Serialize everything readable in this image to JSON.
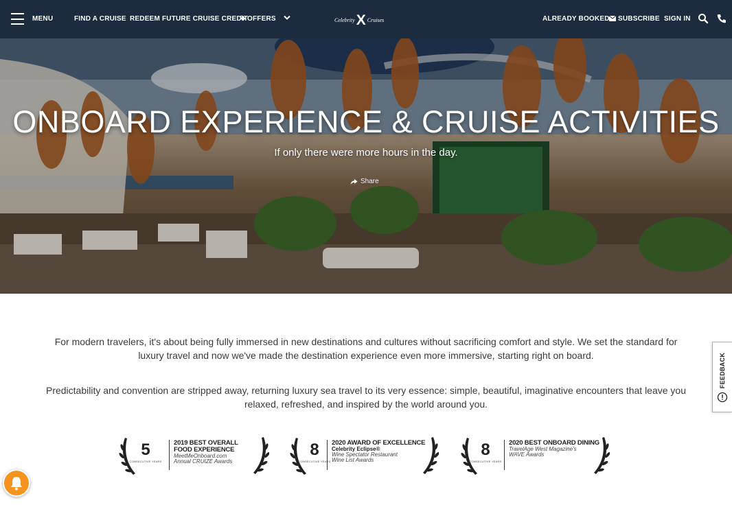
{
  "header": {
    "menu_label": "MENU",
    "nav": [
      "FIND A CRUISE",
      "REDEEM FUTURE CRUISE CREDIT",
      "OFFERS"
    ],
    "logo": {
      "word1": "Celebrity",
      "mark": "X",
      "word2": "Cruises"
    },
    "right": [
      "ALREADY BOOKED",
      "SUBSCRIBE",
      "SIGN IN"
    ],
    "icons": [
      "menu-icon",
      "tag-icon",
      "chevron-down-icon",
      "envelope-icon",
      "search-icon",
      "phone-icon"
    ]
  },
  "hero": {
    "title": "ONBOARD EXPERIENCE & CRUISE ACTIVITIES",
    "subtitle": "If only there were more hours in the day.",
    "share_label": "Share"
  },
  "content": {
    "paragraph1": "For modern travelers, it's about being fully immersed in new destinations and cultures without sacrificing comfort and style. We set the standard for luxury travel and now we've made the destination experience even more immersive, starting right on board.",
    "paragraph2": "Predictability and convention are stripped away, returning luxury sea travel to its very essence: simple, beautiful, imaginative encounters that leave you relaxed, refreshed, and inspired by the world around you."
  },
  "awards": [
    {
      "number": "5",
      "consecutive": "CONSECUTIVE YEARS",
      "title": "2019 BEST OVERALL FOOD EXPERIENCE",
      "lines": [
        "MeetMeOnboard.com",
        "Annual CRUIZE Awards"
      ],
      "bold_line": ""
    },
    {
      "number": "8",
      "consecutive": "CONSECUTIVE YEARS",
      "title": "2020 AWARD OF EXCELLENCE",
      "bold_line": "Celebrity Eclipse®",
      "lines": [
        "Wine Spectator Restaurant",
        "Wine List Awards"
      ]
    },
    {
      "number": "8",
      "consecutive": "CONSECUTIVE YEARS",
      "title": "2020 BEST ONBOARD DINING",
      "lines": [
        "TravelAge West Magazine's",
        "WAVE Awards"
      ],
      "bold_line": ""
    }
  ],
  "feedback": {
    "label": "FEEDBACK"
  },
  "colors": {
    "header_bg": "#1c2b3d",
    "notification": "#f6921e",
    "text": "#3a3a3a"
  }
}
